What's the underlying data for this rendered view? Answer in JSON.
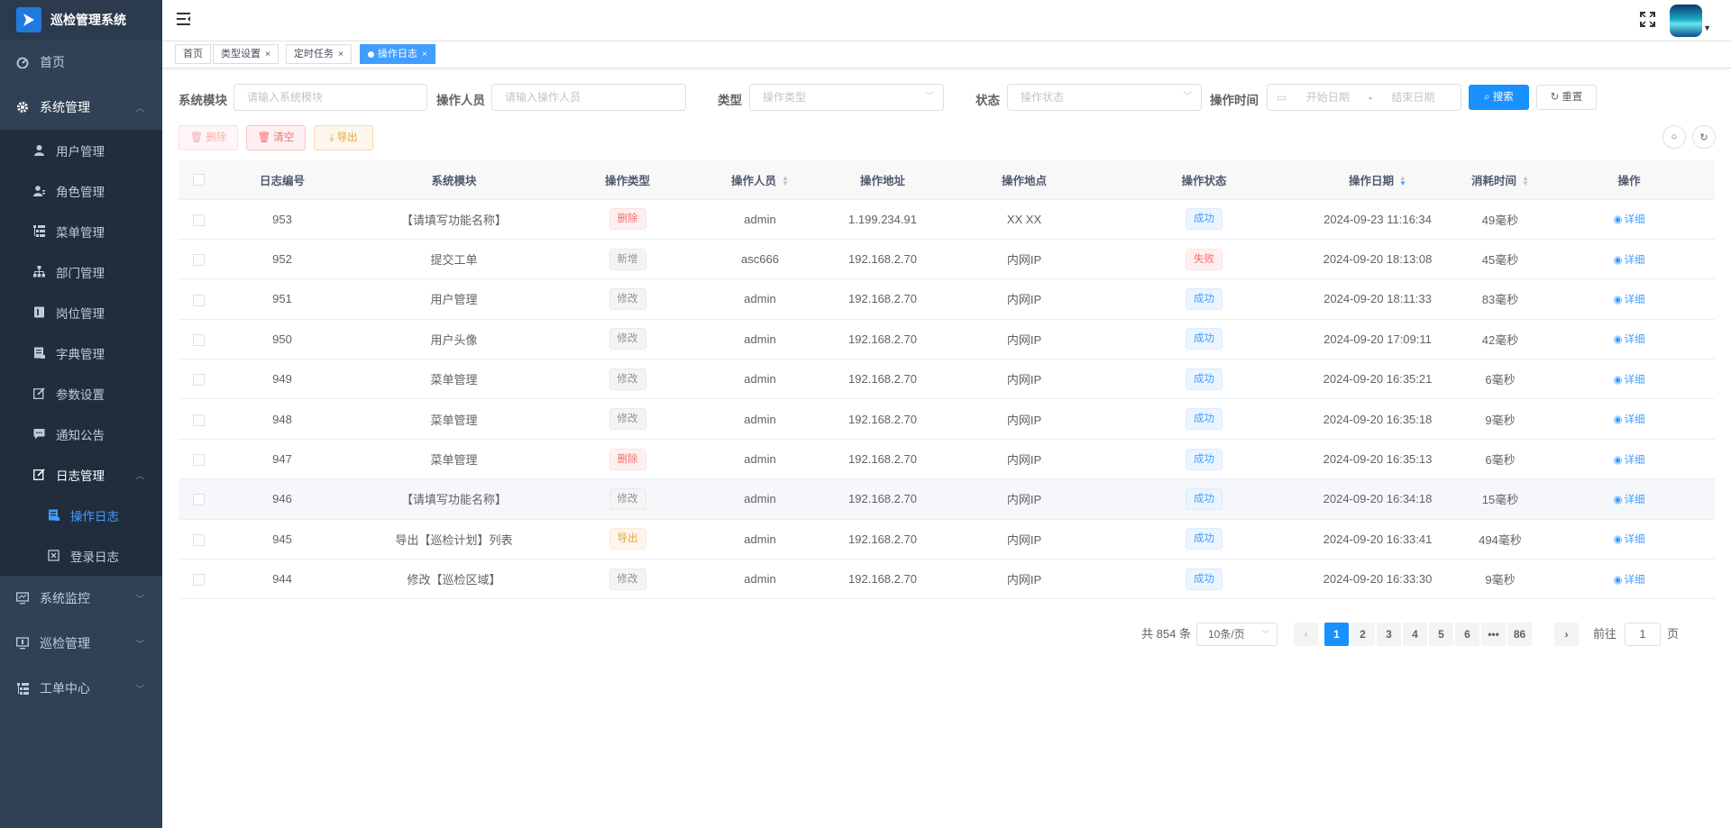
{
  "app": {
    "title": "巡检管理系统"
  },
  "sidebar": {
    "home": "首页",
    "system": {
      "label": "系统管理",
      "items": [
        "用户管理",
        "角色管理",
        "菜单管理",
        "部门管理",
        "岗位管理",
        "字典管理",
        "参数设置",
        "通知公告"
      ]
    },
    "log": {
      "label": "日志管理",
      "items": [
        "操作日志",
        "登录日志"
      ]
    },
    "monitor": "系统监控",
    "inspection": "巡检管理",
    "workorder": "工单中心"
  },
  "tags": [
    "首页",
    "类型设置",
    "定时任务",
    "操作日志"
  ],
  "search": {
    "module_label": "系统模块",
    "module_placeholder": "请输入系统模块",
    "operator_label": "操作人员",
    "operator_placeholder": "请输入操作人员",
    "type_label": "类型",
    "type_placeholder": "操作类型",
    "status_label": "状态",
    "status_placeholder": "操作状态",
    "time_label": "操作时间",
    "start_placeholder": "开始日期",
    "range_sep": "-",
    "end_placeholder": "结束日期",
    "search_btn": "搜索",
    "reset_btn": "重置"
  },
  "toolbar": {
    "delete": "删除",
    "clear": "清空",
    "export": "导出"
  },
  "table": {
    "headers": [
      "日志编号",
      "系统模块",
      "操作类型",
      "操作人员",
      "操作地址",
      "操作地点",
      "操作状态",
      "操作日期",
      "消耗时间",
      "操作"
    ],
    "detail_label": "详细",
    "rows": [
      {
        "id": "953",
        "module": "【请填写功能名称】",
        "type": "删除",
        "type_style": "danger",
        "user": "admin",
        "ip": "1.199.234.91",
        "location": "XX XX",
        "status": "成功",
        "status_style": "primary",
        "date": "2024-09-23 11:16:34",
        "cost": "49毫秒"
      },
      {
        "id": "952",
        "module": "提交工单",
        "type": "新增",
        "type_style": "info",
        "user": "asc666",
        "ip": "192.168.2.70",
        "location": "内网IP",
        "status": "失败",
        "status_style": "danger",
        "date": "2024-09-20 18:13:08",
        "cost": "45毫秒"
      },
      {
        "id": "951",
        "module": "用户管理",
        "type": "修改",
        "type_style": "info",
        "user": "admin",
        "ip": "192.168.2.70",
        "location": "内网IP",
        "status": "成功",
        "status_style": "primary",
        "date": "2024-09-20 18:11:33",
        "cost": "83毫秒"
      },
      {
        "id": "950",
        "module": "用户头像",
        "type": "修改",
        "type_style": "info",
        "user": "admin",
        "ip": "192.168.2.70",
        "location": "内网IP",
        "status": "成功",
        "status_style": "primary",
        "date": "2024-09-20 17:09:11",
        "cost": "42毫秒"
      },
      {
        "id": "949",
        "module": "菜单管理",
        "type": "修改",
        "type_style": "info",
        "user": "admin",
        "ip": "192.168.2.70",
        "location": "内网IP",
        "status": "成功",
        "status_style": "primary",
        "date": "2024-09-20 16:35:21",
        "cost": "6毫秒"
      },
      {
        "id": "948",
        "module": "菜单管理",
        "type": "修改",
        "type_style": "info",
        "user": "admin",
        "ip": "192.168.2.70",
        "location": "内网IP",
        "status": "成功",
        "status_style": "primary",
        "date": "2024-09-20 16:35:18",
        "cost": "9毫秒"
      },
      {
        "id": "947",
        "module": "菜单管理",
        "type": "删除",
        "type_style": "danger",
        "user": "admin",
        "ip": "192.168.2.70",
        "location": "内网IP",
        "status": "成功",
        "status_style": "primary",
        "date": "2024-09-20 16:35:13",
        "cost": "6毫秒"
      },
      {
        "id": "946",
        "module": "【请填写功能名称】",
        "type": "修改",
        "type_style": "info",
        "user": "admin",
        "ip": "192.168.2.70",
        "location": "内网IP",
        "status": "成功",
        "status_style": "primary",
        "date": "2024-09-20 16:34:18",
        "cost": "15毫秒"
      },
      {
        "id": "945",
        "module": "导出【巡检计划】列表",
        "type": "导出",
        "type_style": "warning",
        "user": "admin",
        "ip": "192.168.2.70",
        "location": "内网IP",
        "status": "成功",
        "status_style": "primary",
        "date": "2024-09-20 16:33:41",
        "cost": "494毫秒"
      },
      {
        "id": "944",
        "module": "修改【巡检区域】",
        "type": "修改",
        "type_style": "info",
        "user": "admin",
        "ip": "192.168.2.70",
        "location": "内网IP",
        "status": "成功",
        "status_style": "primary",
        "date": "2024-09-20 16:33:30",
        "cost": "9毫秒"
      }
    ]
  },
  "pagination": {
    "total": "共 854 条",
    "page_size": "10条/页",
    "pages": [
      "1",
      "2",
      "3",
      "4",
      "5",
      "6",
      "•••",
      "86"
    ],
    "current": "1",
    "jump_prefix": "前往",
    "jump_value": "1",
    "jump_suffix": "页"
  }
}
